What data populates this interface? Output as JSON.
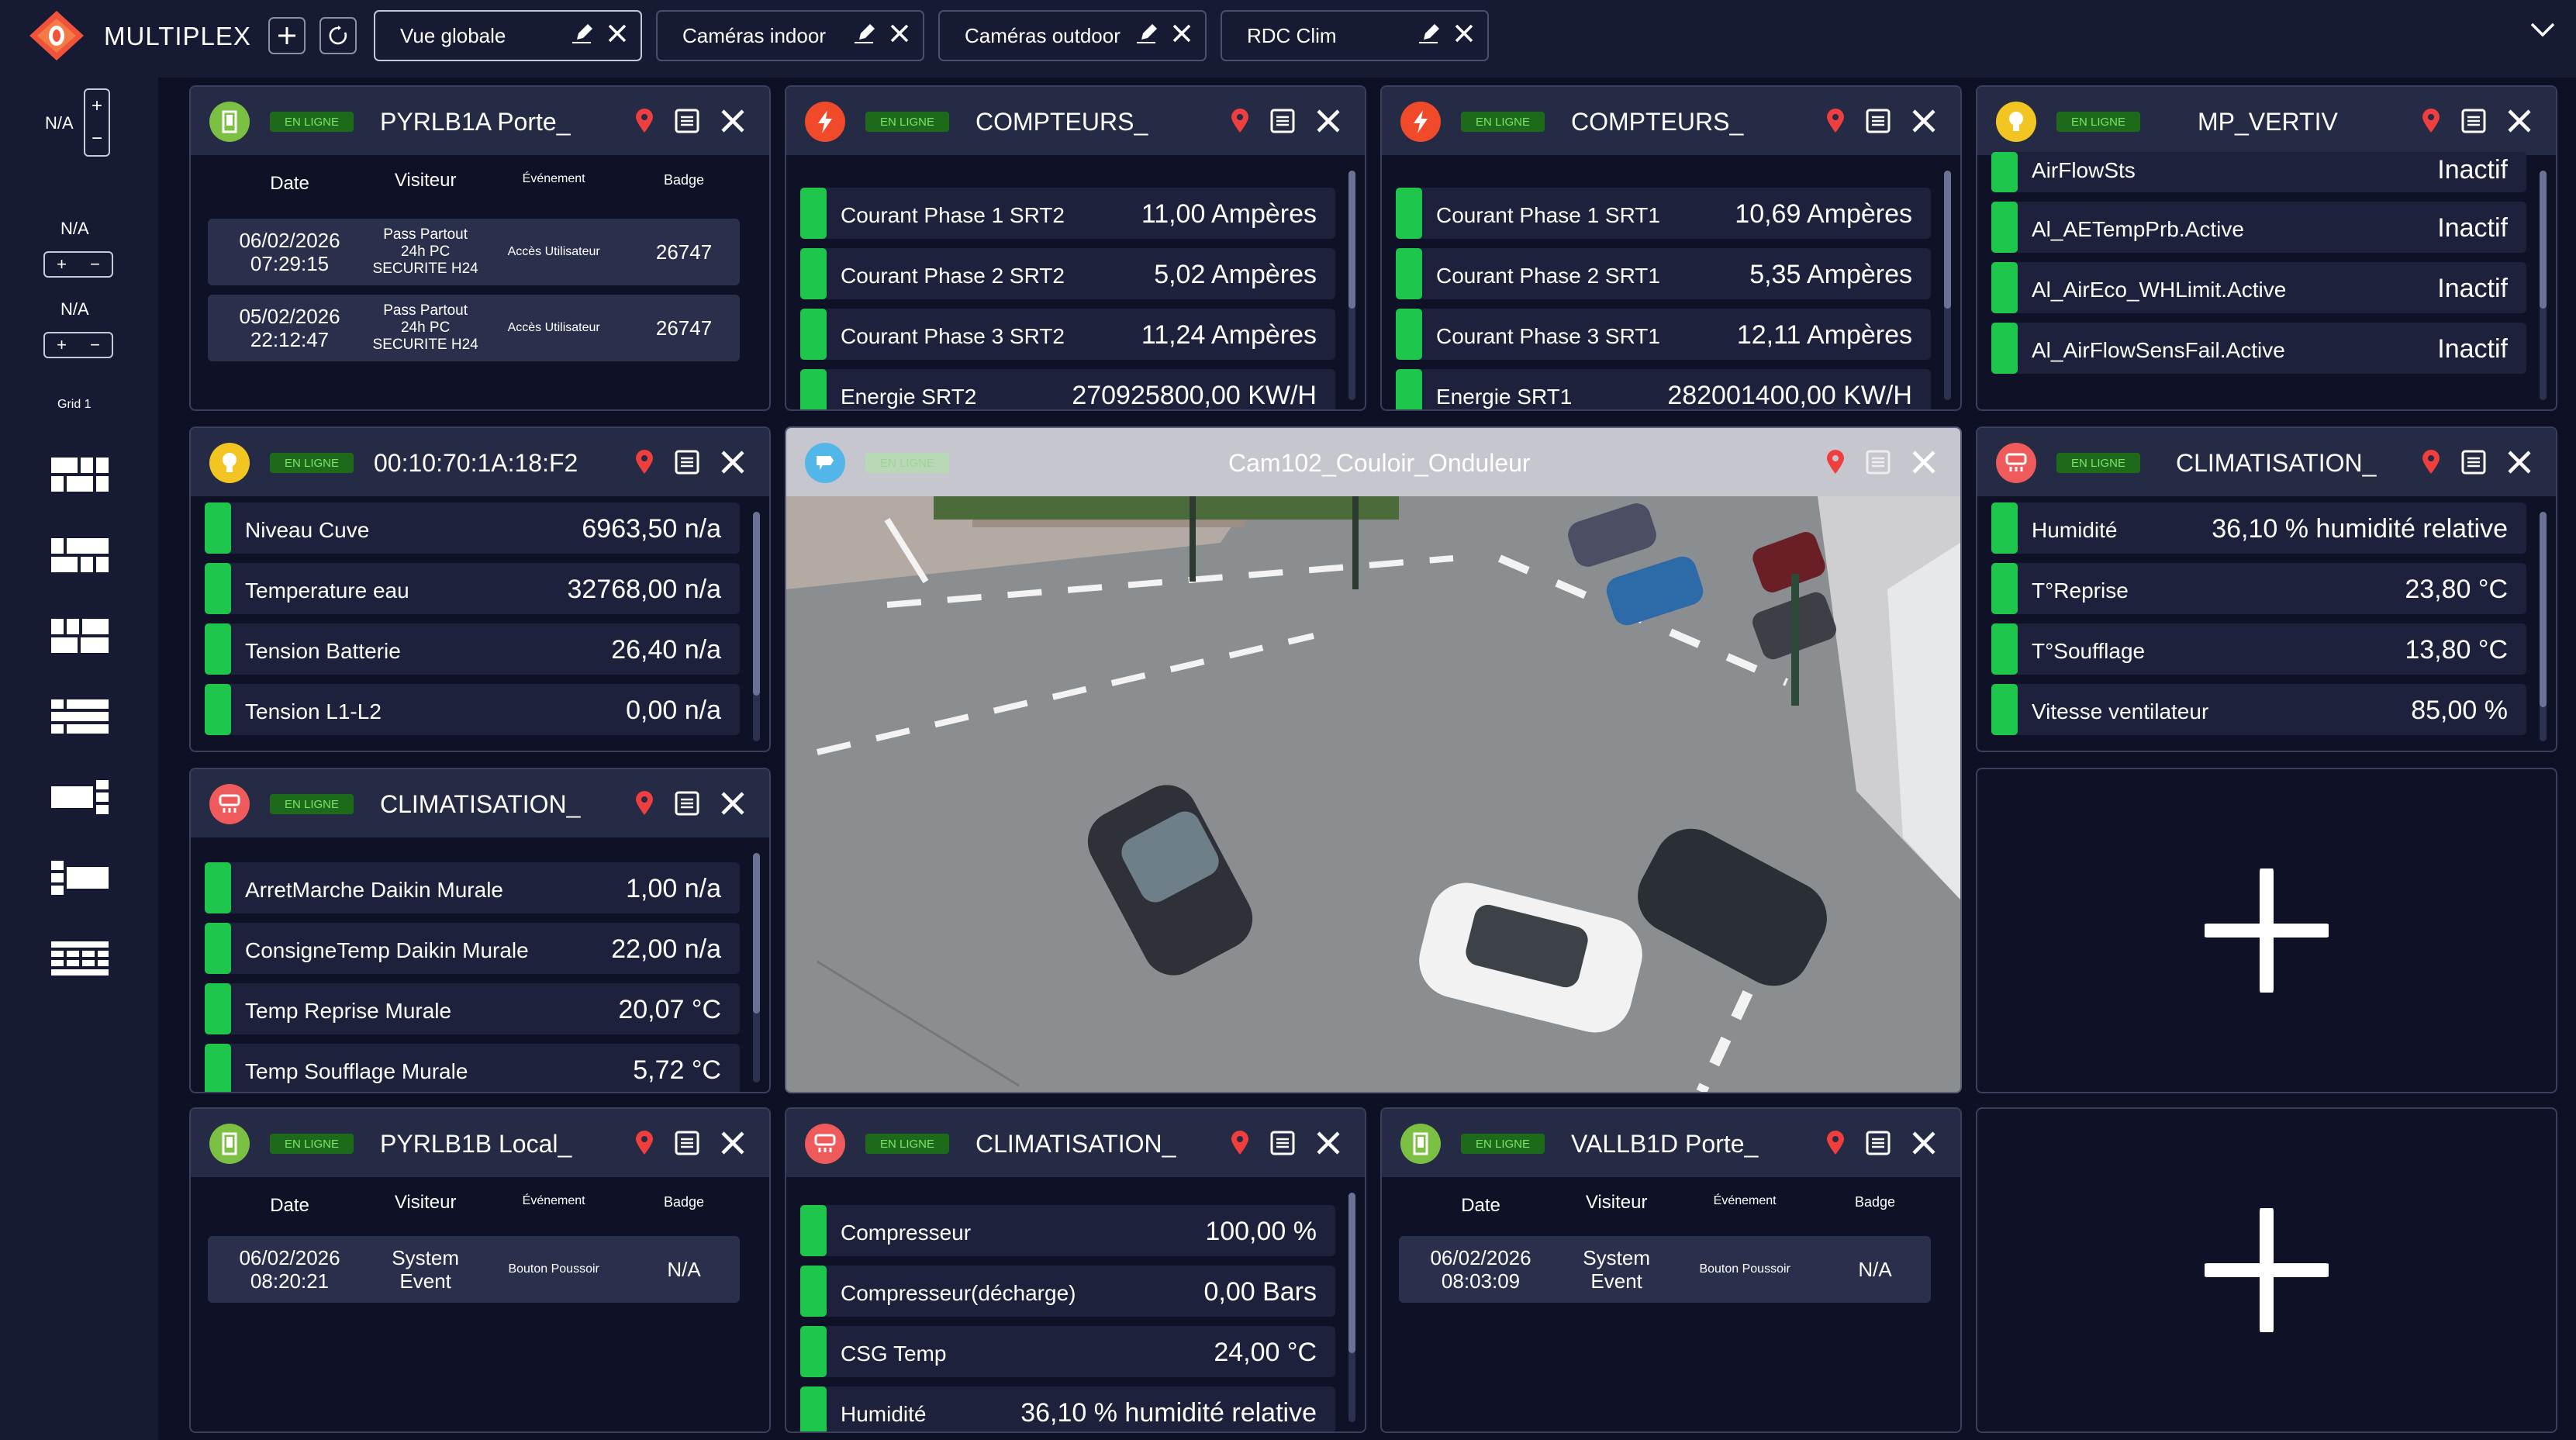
{
  "app": {
    "name": "MULTIPLEX"
  },
  "tabs": [
    {
      "label": "Vue globale",
      "active": true
    },
    {
      "label": "Caméras indoor",
      "active": false
    },
    {
      "label": "Caméras outdoor",
      "active": false
    },
    {
      "label": "RDC Clim",
      "active": false
    }
  ],
  "sidebar": {
    "top_value": "N/A",
    "value2": "N/A",
    "value3": "N/A",
    "grid_label": "Grid 1",
    "plus": "+",
    "minus": "−"
  },
  "colors": {
    "online_bg": "#1d6a1a",
    "online_text": "#7be36b",
    "value_bar": "#1ec74b",
    "header_bg": "#252a45",
    "badge_lightning": "#f04a2b",
    "badge_bulb": "#f2c522",
    "badge_clim": "#ef5a5a",
    "badge_door": "#7bc043",
    "badge_cam": "#52b7e8"
  },
  "access_headers": {
    "date": "Date",
    "visitor": "Visiteur",
    "event": "Événement",
    "badge": "Badge"
  },
  "panels": {
    "pyrlb1a": {
      "status": "EN LIGNE",
      "title": "PYRLB1A Porte_",
      "rows": [
        {
          "date": "06/02/2026",
          "time": "07:29:15",
          "visitor": [
            "Pass Partout",
            "24h PC",
            "SECURITE H24"
          ],
          "event": "Accès Utilisateur",
          "badge": "26747"
        },
        {
          "date": "05/02/2026",
          "time": "22:12:47",
          "visitor": [
            "Pass Partout",
            "24h PC",
            "SECURITE H24"
          ],
          "event": "Accès Utilisateur",
          "badge": "26747"
        }
      ]
    },
    "compteurs_srt2": {
      "status": "EN LIGNE",
      "title": "COMPTEURS_",
      "rows": [
        {
          "label": "Courant Phase 1 SRT2",
          "value": "11,00 Ampères"
        },
        {
          "label": "Courant Phase 2 SRT2",
          "value": "5,02 Ampères"
        },
        {
          "label": "Courant Phase 3 SRT2",
          "value": "11,24 Ampères"
        },
        {
          "label": "Energie SRT2",
          "value": "270925800,00 KW/H"
        }
      ]
    },
    "compteurs_srt1": {
      "status": "EN LIGNE",
      "title": "COMPTEURS_",
      "rows": [
        {
          "label": "Courant Phase 1 SRT1",
          "value": "10,69 Ampères"
        },
        {
          "label": "Courant Phase 2 SRT1",
          "value": "5,35 Ampères"
        },
        {
          "label": "Courant Phase 3 SRT1",
          "value": "12,11 Ampères"
        },
        {
          "label": "Energie SRT1",
          "value": "282001400,00 KW/H"
        }
      ]
    },
    "mp_vertiv": {
      "status": "EN LIGNE",
      "title": "MP_VERTIV",
      "rows": [
        {
          "label": "AirFlowSts",
          "value": "Inactif"
        },
        {
          "label": "Al_AETempPrb.Active",
          "value": "Inactif"
        },
        {
          "label": "Al_AirEco_WHLimit.Active",
          "value": "Inactif"
        },
        {
          "label": "Al_AirFlowSensFail.Active",
          "value": "Inactif"
        }
      ]
    },
    "mac_device": {
      "status": "EN LIGNE",
      "title": "00:10:70:1A:18:F2",
      "rows": [
        {
          "label": "Niveau Cuve",
          "value": "6963,50 n/a"
        },
        {
          "label": "Temperature eau",
          "value": "32768,00 n/a"
        },
        {
          "label": "Tension Batterie",
          "value": "26,40 n/a"
        },
        {
          "label": "Tension L1-L2",
          "value": "0,00 n/a"
        }
      ]
    },
    "camera": {
      "status": "EN LIGNE",
      "title": "Cam102_Couloir_Onduleur"
    },
    "clim_right": {
      "status": "EN LIGNE",
      "title": "CLIMATISATION_",
      "rows": [
        {
          "label": "Humidité",
          "value": "36,10 % humidité relative"
        },
        {
          "label": "T°Reprise",
          "value": "23,80 °C"
        },
        {
          "label": "T°Soufflage",
          "value": "13,80 °C"
        },
        {
          "label": "Vitesse ventilateur",
          "value": "85,00 %"
        }
      ]
    },
    "clim_left": {
      "status": "EN LIGNE",
      "title": "CLIMATISATION_",
      "rows": [
        {
          "label": "ArretMarche Daikin Murale",
          "value": "1,00 n/a"
        },
        {
          "label": "ConsigneTemp Daikin Murale",
          "value": "22,00 n/a"
        },
        {
          "label": "Temp Reprise Murale",
          "value": "20,07 °C"
        },
        {
          "label": "Temp Soufflage Murale",
          "value": "5,72 °C"
        }
      ]
    },
    "pyrlb1b": {
      "status": "EN LIGNE",
      "title": "PYRLB1B Local_",
      "rows": [
        {
          "date": "06/02/2026",
          "time": "08:20:21",
          "visitor": [
            "System",
            "Event"
          ],
          "event": "Bouton Poussoir",
          "badge": "N/A"
        }
      ]
    },
    "clim_bottom": {
      "status": "EN LIGNE",
      "title": "CLIMATISATION_",
      "rows": [
        {
          "label": "Compresseur",
          "value": "100,00 %"
        },
        {
          "label": "Compresseur(décharge)",
          "value": "0,00 Bars"
        },
        {
          "label": "CSG Temp",
          "value": "24,00 °C"
        },
        {
          "label": "Humidité",
          "value": "36,10 % humidité relative"
        }
      ]
    },
    "vallb1d": {
      "status": "EN LIGNE",
      "title": "VALLB1D Porte_",
      "rows": [
        {
          "date": "06/02/2026",
          "time": "08:03:09",
          "visitor": [
            "System",
            "Event"
          ],
          "event": "Bouton Poussoir",
          "badge": "N/A"
        }
      ]
    }
  },
  "add_tile": {
    "icon": "plus-icon"
  }
}
